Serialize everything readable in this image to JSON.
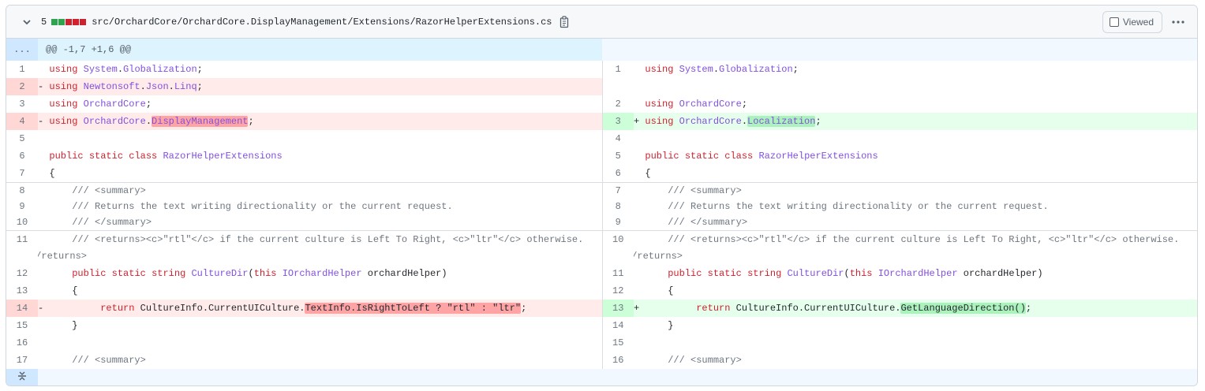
{
  "file": {
    "change_count": "5",
    "path": "src/OrchardCore/OrchardCore.DisplayManagement/Extensions/RazorHelperExtensions.cs",
    "viewed_label": "Viewed",
    "hunk_header": "@@ -1,7 +1,6 @@",
    "expand_label": "...",
    "colors": {
      "added": "#2da44e",
      "deleted": "#cf222e",
      "hunk_bg": "#ddf4ff"
    }
  },
  "lines": {
    "l1": "1",
    "l2": "2",
    "l3": "3",
    "l4": "4",
    "l5": "5",
    "l6": "6",
    "l7": "7",
    "l8": "8",
    "l9": "9",
    "l10": "10",
    "l11": "11",
    "l12": "12",
    "l13": "13",
    "l14": "14",
    "l15": "15",
    "l16": "16",
    "l17": "17",
    "marker_del": "-",
    "marker_add": "+",
    "using": "using",
    "public": "public",
    "static": "static",
    "class": "class",
    "string": "string",
    "this": "this",
    "return": "return",
    "ns_system": "System",
    "ns_globalization": "Globalization",
    "ns_newtonsoft": "Newtonsoft",
    "ns_json": "Json",
    "ns_linq": "Linq",
    "ns_orchard": "OrchardCore",
    "ns_displaymgmt": "DisplayManagement",
    "ns_localization": "Localization",
    "class_name": "RazorHelperExtensions",
    "brace_open": "{",
    "brace_close": "}",
    "doc_summary_open": "/// <summary>",
    "doc_returns_text": "/// Returns the text writing directionality or the current request.",
    "doc_summary_close": "/// </summary>",
    "doc_returns_tag": "/// <returns><c>\"rtl\"</c> if the current culture is Left To Right, <c>\"ltr\"</c> otherwise.",
    "doc_returns_end": "</returns>",
    "method_name": "CultureDir",
    "param_type": "IOrchardHelper",
    "param_name": "orchardHelper",
    "culture_prefix": "CultureInfo.CurrentUICulture.",
    "old_expr": "TextInfo.IsRightToLeft ? \"rtl\" : \"ltr\"",
    "new_expr": "GetLanguageDirection()",
    "semicolon": ";"
  }
}
